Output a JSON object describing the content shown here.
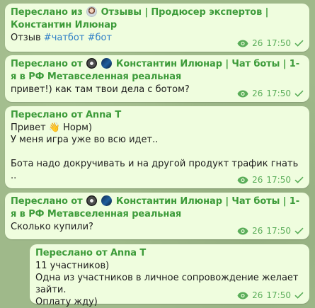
{
  "messages": [
    {
      "forward_prefix": "Переслано из",
      "forward_source": "Отзывы | Продюсер экспертов | Константин Илюнар",
      "text": "Отзыв",
      "hashtags": [
        "#чатбот",
        "#бот"
      ],
      "views": "26",
      "time": "17:50"
    },
    {
      "forward_prefix": "Переслано от",
      "forward_source": "Константин Илюнар | Чат боты | 1-я в РФ Метавселенная реальная",
      "text": "привет!) как там твои дела с ботом?",
      "views": "26",
      "time": "17:50"
    },
    {
      "forward_prefix": "Переслано от",
      "forward_source": "Anna T",
      "lines": [
        "Привет 👋 Норм)",
        "У меня игра уже во всю идет..",
        "",
        "Бота надо докручивать и на другой продукт трафик гнать .."
      ],
      "views": "26",
      "time": "17:50"
    },
    {
      "forward_prefix": "Переслано от",
      "forward_source": "Константин Илюнар | Чат боты | 1-я в РФ Метавселенная реальная",
      "text": "Сколько купили?",
      "views": "26",
      "time": "17:50"
    },
    {
      "forward_prefix": "Переслано от",
      "forward_source": "Anna T",
      "lines": [
        "11 участников)",
        "Одна из участников в личное сопровождение желает зайти.",
        "Оплату жду)"
      ],
      "views": "26",
      "time": "17:50"
    }
  ],
  "colors": {
    "bubble": "#effdde",
    "forward_header": "#3d9b3a",
    "hashtag": "#2f7fc7",
    "meta": "#5aad59"
  }
}
